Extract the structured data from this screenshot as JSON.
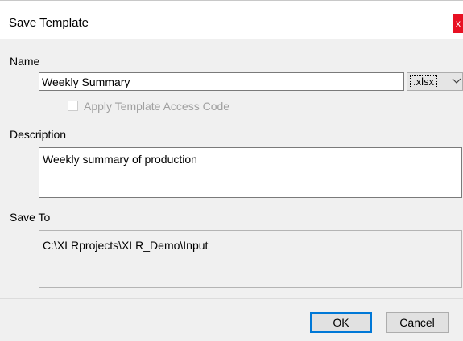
{
  "window": {
    "title": "Save Template",
    "close_label": "x"
  },
  "name_section": {
    "label": "Name",
    "value": "Weekly Summary",
    "extension": {
      "selected": ".xlsx",
      "icon": "chevron-down-icon"
    },
    "access_code": {
      "label": "Apply Template Access Code",
      "checked": false,
      "enabled": false
    }
  },
  "description_section": {
    "label": "Description",
    "value": "Weekly summary of production"
  },
  "save_to_section": {
    "label": "Save To",
    "value": "C:\\XLRprojects\\XLR_Demo\\Input"
  },
  "buttons": {
    "ok": "OK",
    "cancel": "Cancel"
  },
  "colors": {
    "close_button": "#e81123",
    "default_button_border": "#0078d7",
    "dialog_background": "#f0f0f0"
  }
}
